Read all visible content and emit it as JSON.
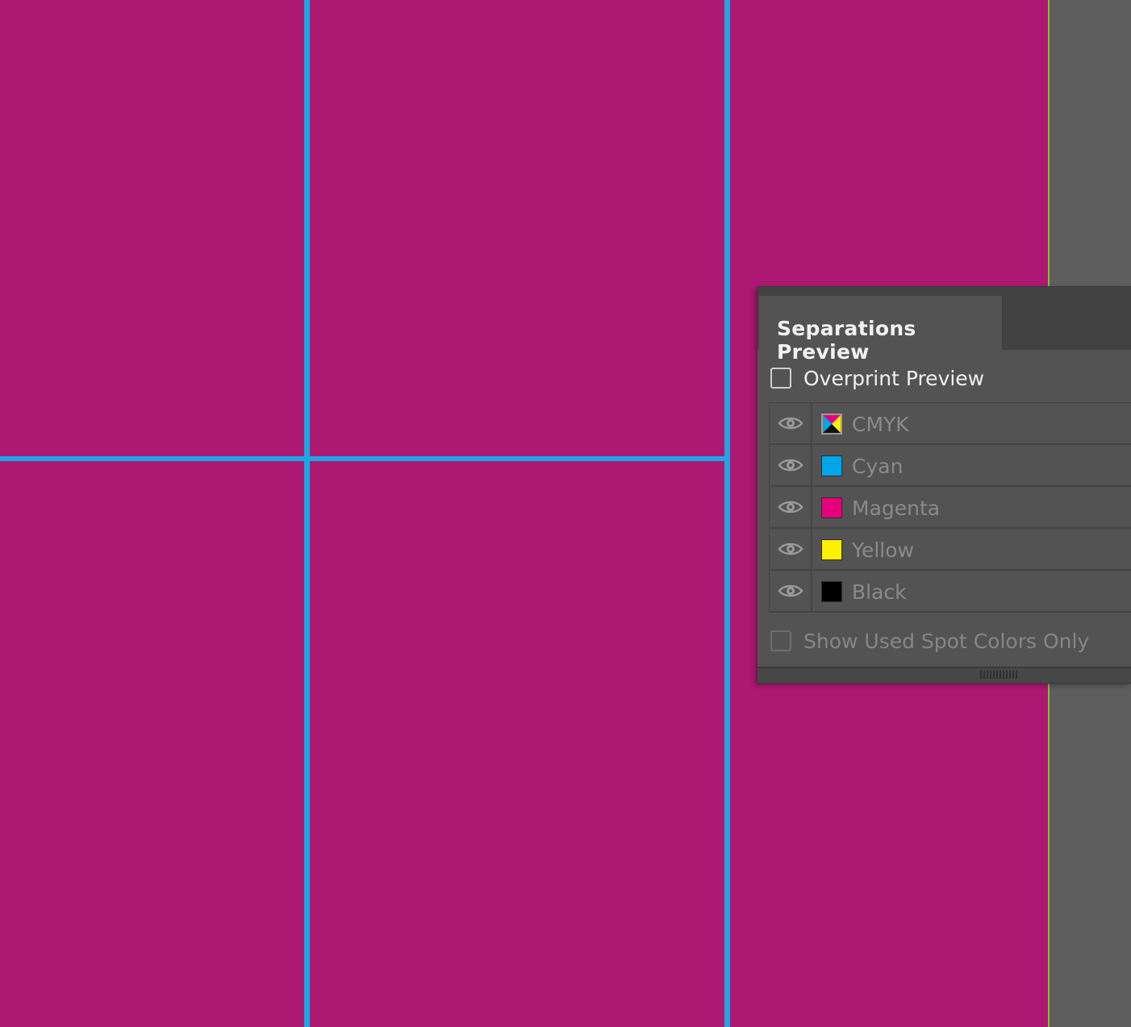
{
  "canvas": {
    "artboard_color": "#ad1972",
    "guide_color": "#1aa8e6",
    "pasteboard_color": "#5e5e5e"
  },
  "panel": {
    "title": "Separations Preview",
    "overprint_label": "Overprint Preview",
    "overprint_checked": false,
    "separations": [
      {
        "name": "CMYK",
        "swatch": "cmyk-composite-icon",
        "visible": true
      },
      {
        "name": "Cyan",
        "swatch_color": "#00a6e8",
        "visible": true
      },
      {
        "name": "Magenta",
        "swatch_color": "#e4007c",
        "visible": true
      },
      {
        "name": "Yellow",
        "swatch_color": "#fff000",
        "visible": true
      },
      {
        "name": "Black",
        "swatch_color": "#000000",
        "visible": true
      }
    ],
    "spot_only_label": "Show Used Spot Colors Only",
    "spot_only_checked": false,
    "icons": {
      "visibility": "eye-icon",
      "resize": "resize-grip-icon"
    }
  }
}
